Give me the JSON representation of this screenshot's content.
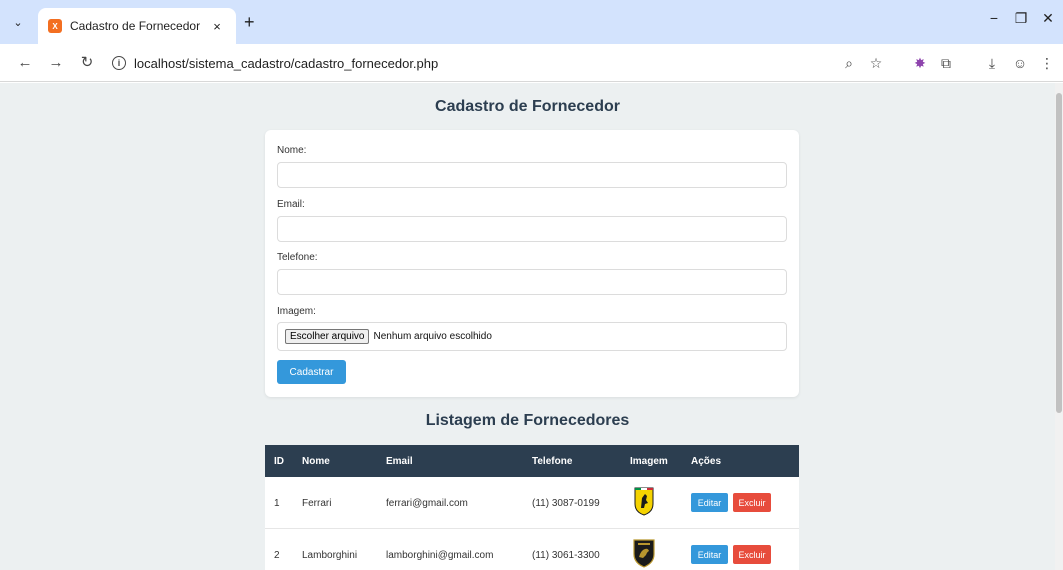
{
  "browser": {
    "tab_title": "Cadastro de Fornecedor",
    "tab_close": "×",
    "new_tab": "+",
    "url": "localhost/sistema_cadastro/cadastro_fornecedor.php",
    "icons": [
      "tab-search-icon",
      "back-icon",
      "forward-icon",
      "reload-icon",
      "site-info-icon",
      "zoom-icon",
      "bookmark-star-icon",
      "extension-icon",
      "extensions-puzzle-icon",
      "download-icon",
      "profile-icon",
      "menu-kebab-icon",
      "minimize-icon",
      "restore-icon",
      "close-window-icon"
    ]
  },
  "form": {
    "title": "Cadastro de Fornecedor",
    "nome_label": "Nome:",
    "email_label": "Email:",
    "telefone_label": "Telefone:",
    "imagem_label": "Imagem:",
    "nome_value": "",
    "email_value": "",
    "telefone_value": "",
    "file_button": "Escolher arquivo",
    "file_status": "Nenhum arquivo escolhido",
    "submit": "Cadastrar"
  },
  "list": {
    "title": "Listagem de Fornecedores",
    "headers": [
      "ID",
      "Nome",
      "Email",
      "Telefone",
      "Imagem",
      "Ações"
    ],
    "rows": [
      {
        "id": "1",
        "nome": "Ferrari",
        "email": "ferrari@gmail.com",
        "telefone": "(11) 3087-0199",
        "logo": "ferrari-logo-icon",
        "edit": "Editar",
        "delete": "Excluir"
      },
      {
        "id": "2",
        "nome": "Lamborghini",
        "email": "lamborghini@gmail.com",
        "telefone": "(11) 3061-3300",
        "logo": "lamborghini-logo-icon",
        "edit": "Editar",
        "delete": "Excluir"
      }
    ]
  },
  "colors": {
    "tabstrip": "#d3e3fd",
    "page_bg": "#ecf0f1",
    "header_bg": "#2c3e50",
    "primary": "#3498db",
    "danger": "#e74c3c"
  }
}
